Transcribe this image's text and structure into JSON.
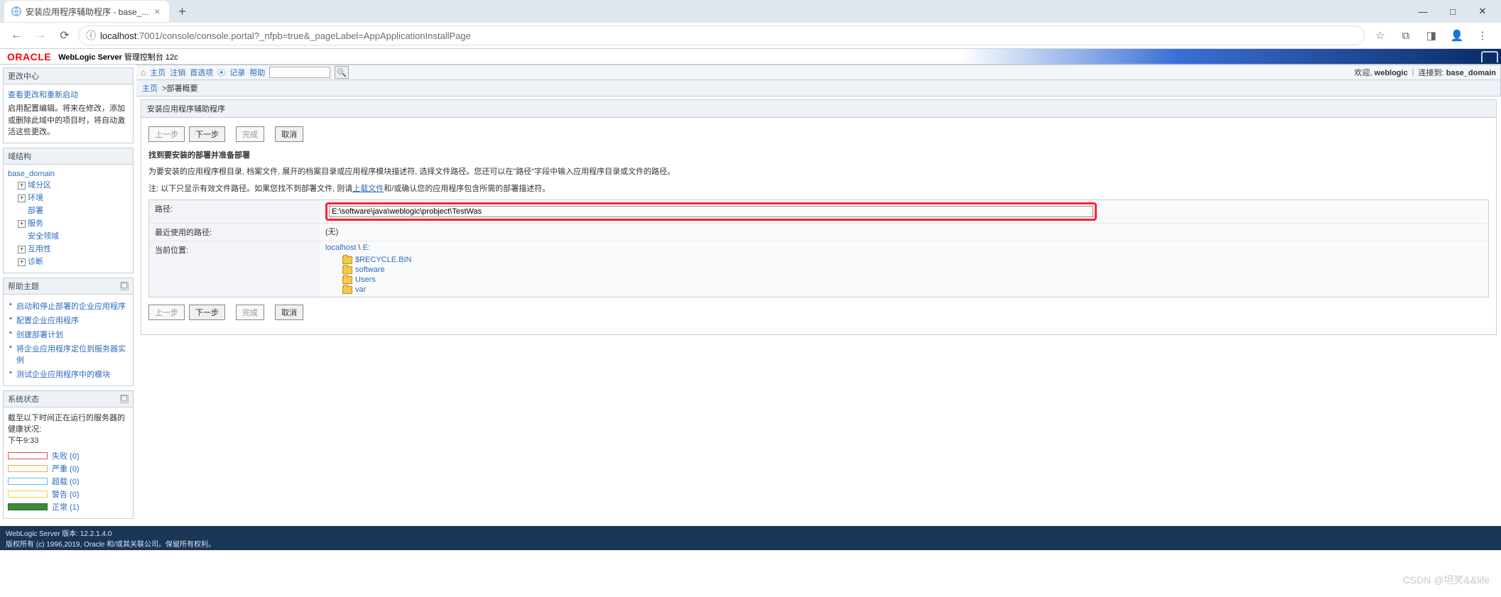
{
  "browser": {
    "tab_title": "安装应用程序辅助程序 - base_...",
    "url_host": "localhost",
    "url_path": ":7001/console/console.portal?_nfpb=true&_pageLabel=AppApplicationInstallPage"
  },
  "header": {
    "logo_text": "ORACLE",
    "product_bold": "WebLogic Server",
    "product_rest": " 管理控制台 12c"
  },
  "change_center": {
    "title": "更改中心",
    "link": "查看更改和重新启动",
    "desc": "启用配置编辑。将来在修改，添加或删除此域中的项目时，将自动激活这些更改。"
  },
  "domain_tree": {
    "title": "域结构",
    "root": "base_domain",
    "items": [
      {
        "toggle": "+",
        "label": "域分区"
      },
      {
        "toggle": "+",
        "label": "环境"
      },
      {
        "toggle": "",
        "label": "部署"
      },
      {
        "toggle": "+",
        "label": "服务"
      },
      {
        "toggle": "",
        "label": "安全领域"
      },
      {
        "toggle": "+",
        "label": "互用性"
      },
      {
        "toggle": "+",
        "label": "诊断"
      }
    ]
  },
  "help": {
    "title": "帮助主题",
    "items": [
      "启动和停止部署的企业应用程序",
      "配置企业应用程序",
      "创建部署计划",
      "将企业应用程序定位到服务器实例",
      "测试企业应用程序中的模块"
    ]
  },
  "status": {
    "title": "系统状态",
    "caption": "截至以下时间正在运行的服务器的健康状况:",
    "time": "下午9:33",
    "rows": [
      {
        "cls": "fail",
        "label": "失败 (0)"
      },
      {
        "cls": "crit",
        "label": "严重 (0)"
      },
      {
        "cls": "over",
        "label": "超载 (0)"
      },
      {
        "cls": "warn",
        "label": "警告 (0)"
      },
      {
        "cls": "ok",
        "label": "正常 (1)"
      }
    ]
  },
  "toolbar": {
    "home": "主页",
    "logout": "注销",
    "prefs": "首选项",
    "record": "记录",
    "help": "帮助",
    "search_placeholder": "",
    "welcome_prefix": "欢迎, ",
    "welcome_user": "weblogic",
    "connected_prefix": "连接到: ",
    "connected_domain": "base_domain"
  },
  "breadcrumb": {
    "home": "主页",
    "current": "部署概要"
  },
  "main": {
    "frame_title": "安装应用程序辅助程序",
    "buttons": {
      "back": "上一步",
      "next": "下一步",
      "finish": "完成",
      "cancel": "取消"
    },
    "section_title": "找到要安装的部署并准备部署",
    "para1": "为要安装的应用程序根目录, 档案文件, 展开的档案目录或应用程序模块描述符, 选择文件路径。您还可以在\"路径\"字段中输入应用程序目录或文件的路径。",
    "note_prefix": "注: 以下只显示有效文件路径。如果您找不到部署文件, 则请",
    "note_link": "上载文件",
    "note_suffix": "和/或确认您的应用程序包含所需的部署描述符。",
    "path_label": "路径:",
    "path_value": "E:\\software\\java\\weblogic\\probject\\TestWas",
    "recent_label": "最近使用的路径:",
    "recent_value": "(无)",
    "current_label": "当前位置:",
    "current_host": "localhost",
    "current_sep": " \\ ",
    "current_drive": "E:",
    "dirs": [
      "$RECYCLE.BIN",
      "software",
      "Users",
      "var"
    ]
  },
  "footer": {
    "version": "WebLogic Server 版本: 12.2.1.4.0",
    "copyright": "版权所有 (c) 1996,2019, Oracle 和/或其关联公司。保留所有权利。"
  },
  "watermark": "CSDN @坦笑&&life"
}
